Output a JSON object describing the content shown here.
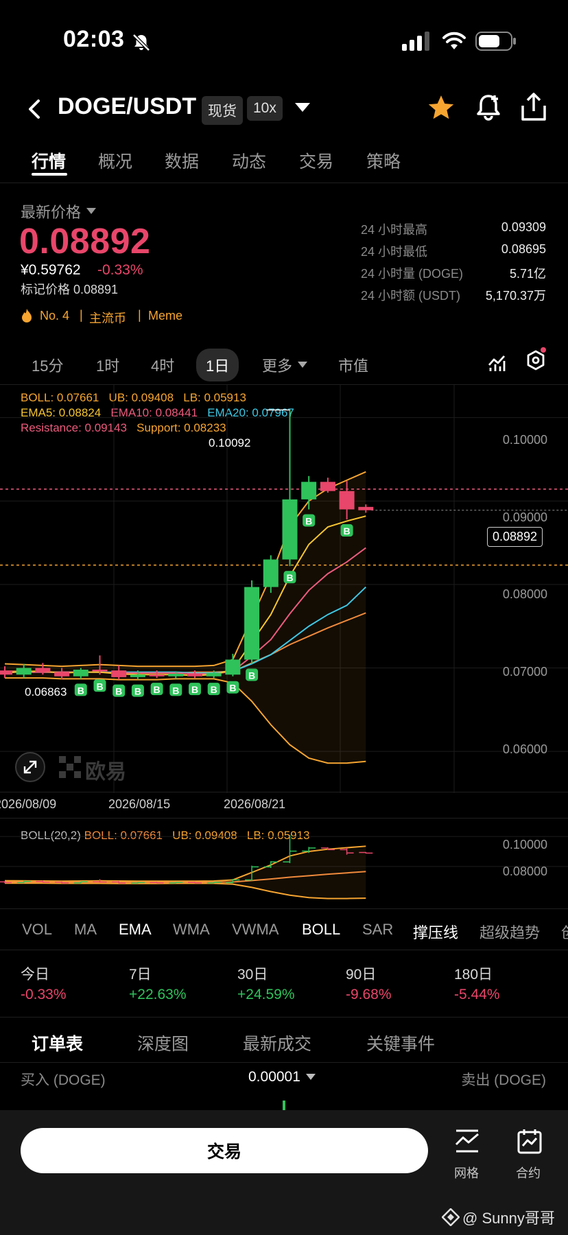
{
  "status": {
    "time": "02:03"
  },
  "header": {
    "pair": "DOGE/USDT",
    "badge_spot": "现货",
    "badge_leverage": "10x"
  },
  "tabs": [
    "行情",
    "概况",
    "数据",
    "动态",
    "交易",
    "策略"
  ],
  "price": {
    "label": "最新价格",
    "last": "0.08892",
    "cny": "¥0.59762",
    "change": "-0.33%",
    "mark": "标记价格 0.08891",
    "tags": [
      "No. 4",
      "主流币",
      "Meme"
    ]
  },
  "stats": [
    {
      "label": "24 小时最高",
      "value": "0.09309"
    },
    {
      "label": "24 小时最低",
      "value": "0.08695"
    },
    {
      "label": "24 小时量 (DOGE)",
      "value": "5.71亿"
    },
    {
      "label": "24 小时额 (USDT)",
      "value": "5,170.37万"
    }
  ],
  "timeframes": [
    "15分",
    "1时",
    "4时",
    "1日",
    "更多",
    "市值"
  ],
  "legend": {
    "boll": "BOLL: 0.07661",
    "ub": "UB: 0.09408",
    "lb": "LB: 0.05913",
    "ema5": "EMA5: 0.08824",
    "ema10": "EMA10: 0.08441",
    "ema20": "EMA20: 0.07967",
    "resistance": "Resistance: 0.09143",
    "support": "Support: 0.08233"
  },
  "chart_data": {
    "type": "candlestick",
    "ylim": [
      0.055,
      0.104
    ],
    "y_ticks": [
      "0.10000",
      "0.09000",
      "0.08000",
      "0.07000",
      "0.06000"
    ],
    "x_ticks": [
      "2026/08/09",
      "2026/08/15",
      "2026/08/21"
    ],
    "high_label": "0.10092",
    "low_label": "0.06863",
    "current_price_label": "0.08892",
    "resistance": 0.09143,
    "support": 0.08233,
    "candles": [
      {
        "o": 0.0697,
        "h": 0.0702,
        "l": 0.0688,
        "c": 0.0692
      },
      {
        "o": 0.0692,
        "h": 0.0705,
        "l": 0.0688,
        "c": 0.07
      },
      {
        "o": 0.07,
        "h": 0.0706,
        "l": 0.0692,
        "c": 0.0695
      },
      {
        "o": 0.0695,
        "h": 0.07,
        "l": 0.0686,
        "c": 0.069
      },
      {
        "o": 0.069,
        "h": 0.07,
        "l": 0.0687,
        "c": 0.0698
      },
      {
        "o": 0.0698,
        "h": 0.0715,
        "l": 0.0692,
        "c": 0.0696
      },
      {
        "o": 0.0697,
        "h": 0.0703,
        "l": 0.0686,
        "c": 0.0689
      },
      {
        "o": 0.0689,
        "h": 0.0697,
        "l": 0.0686,
        "c": 0.0692
      },
      {
        "o": 0.0692,
        "h": 0.0697,
        "l": 0.0688,
        "c": 0.069
      },
      {
        "o": 0.069,
        "h": 0.0696,
        "l": 0.0687,
        "c": 0.0693
      },
      {
        "o": 0.0693,
        "h": 0.0697,
        "l": 0.0688,
        "c": 0.069
      },
      {
        "o": 0.069,
        "h": 0.0697,
        "l": 0.0688,
        "c": 0.0694
      },
      {
        "o": 0.0692,
        "h": 0.0717,
        "l": 0.069,
        "c": 0.071
      },
      {
        "o": 0.071,
        "h": 0.0805,
        "l": 0.0705,
        "c": 0.0797
      },
      {
        "o": 0.0797,
        "h": 0.0835,
        "l": 0.079,
        "c": 0.083
      },
      {
        "o": 0.083,
        "h": 0.10092,
        "l": 0.0822,
        "c": 0.0902
      },
      {
        "o": 0.0902,
        "h": 0.093,
        "l": 0.089,
        "c": 0.0923
      },
      {
        "o": 0.0923,
        "h": 0.0928,
        "l": 0.091,
        "c": 0.0912
      },
      {
        "o": 0.0912,
        "h": 0.0924,
        "l": 0.0878,
        "c": 0.089
      },
      {
        "o": 0.0893,
        "h": 0.0896,
        "l": 0.0886,
        "c": 0.0889
      }
    ],
    "buy_signal_candles": [
      4,
      5,
      6,
      7,
      8,
      9,
      10,
      11,
      12,
      13,
      15,
      16,
      18
    ],
    "brand_watermark": "欧易"
  },
  "sub_chart": {
    "legend_label": "BOLL(20,2)",
    "boll": "BOLL: 0.07661",
    "ub": "UB: 0.09408",
    "lb": "LB: 0.05913",
    "y_ticks": [
      "0.10000",
      "0.08000"
    ]
  },
  "indicators": [
    "VOL",
    "MA",
    "EMA",
    "WMA",
    "VWMA",
    "BOLL",
    "SAR",
    "撑压线",
    "超级趋势",
    "创"
  ],
  "performance": [
    {
      "label": "今日",
      "value": "-0.33%"
    },
    {
      "label": "7日",
      "value": "+22.63%"
    },
    {
      "label": "30日",
      "value": "+24.59%"
    },
    {
      "label": "90日",
      "value": "-9.68%"
    },
    {
      "label": "180日",
      "value": "-5.44%"
    }
  ],
  "orderbook": {
    "tabs": [
      "订单表",
      "深度图",
      "最新成交",
      "关键事件"
    ],
    "buy_label": "买入 (DOGE)",
    "precision": "0.00001",
    "sell_label": "卖出 (DOGE)"
  },
  "footer": {
    "trade": "交易",
    "grid": "网格",
    "contract": "合约",
    "watermark": "@ Sunny哥哥"
  },
  "colors": {
    "up": "#2fc25b",
    "down": "#e8466a",
    "accent": "#f7a531",
    "ema20": "#3fc8e4"
  }
}
